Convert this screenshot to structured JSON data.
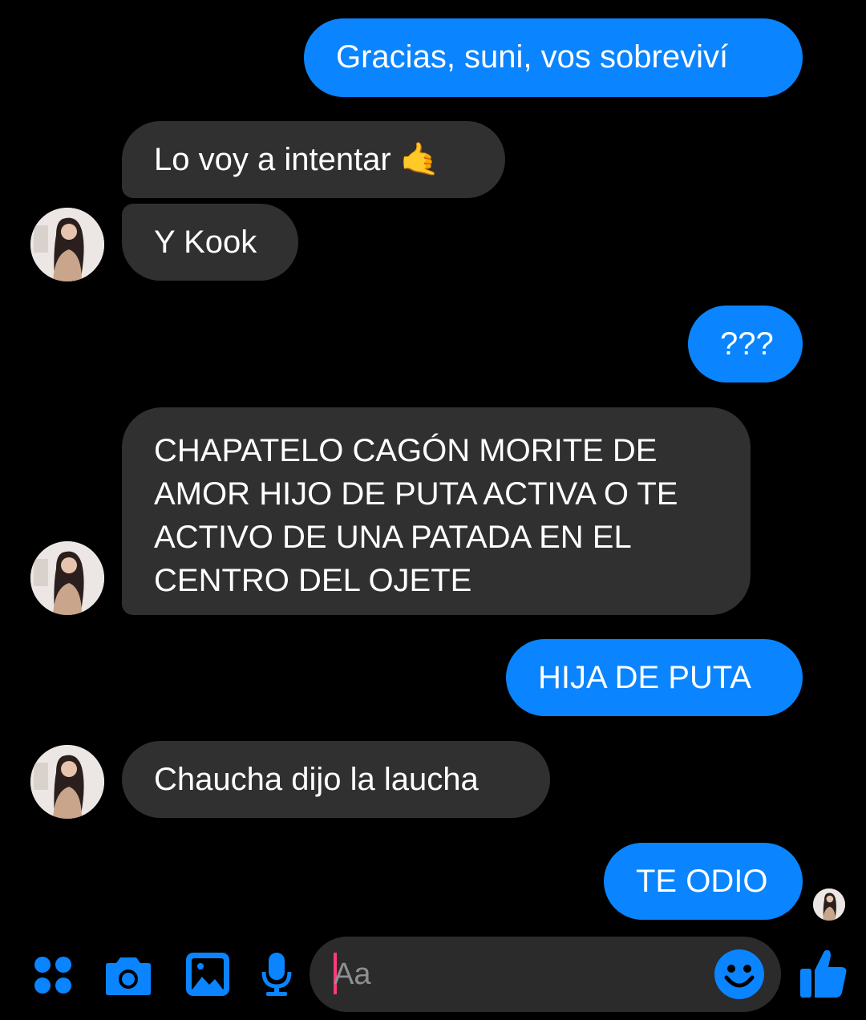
{
  "colors": {
    "background": "#000000",
    "outgoing_bubble": "#0a84ff",
    "incoming_bubble": "#303030",
    "accent": "#0a84ff",
    "caret": "#ff3a7a"
  },
  "messages": [
    {
      "direction": "outgoing",
      "text": "Gracias, suni, vos sobreviví"
    },
    {
      "direction": "incoming",
      "text": "Lo voy a intentar 🤙"
    },
    {
      "direction": "incoming",
      "text": "Y Kook"
    },
    {
      "direction": "outgoing",
      "text": "???"
    },
    {
      "direction": "incoming",
      "text": "CHAPATELO CAGÓN MORITE DE AMOR HIJO DE PUTA ACTIVA O TE ACTIVO DE UNA PATADA EN EL CENTRO DEL OJETE"
    },
    {
      "direction": "outgoing",
      "text": "HIJA DE PUTA"
    },
    {
      "direction": "incoming",
      "text": "Chaucha dijo la laucha"
    },
    {
      "direction": "outgoing",
      "text": "TE ODIO"
    }
  ],
  "composer": {
    "placeholder": "Aa",
    "value": "",
    "icons": [
      "apps-icon",
      "camera-icon",
      "gallery-icon",
      "microphone-icon",
      "emoji-icon",
      "like-icon"
    ]
  }
}
